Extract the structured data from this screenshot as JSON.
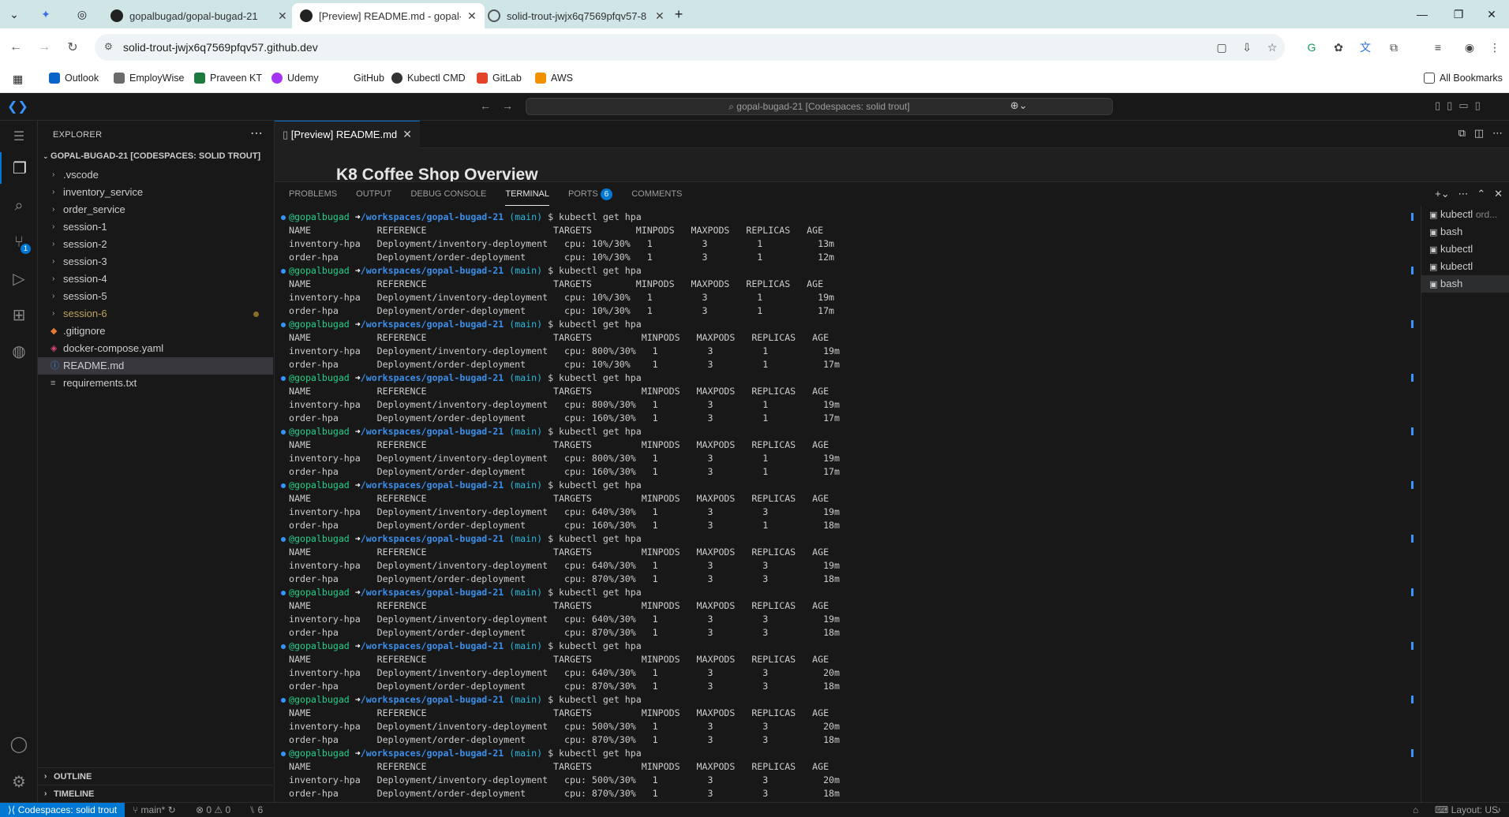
{
  "browser": {
    "tabs": [
      {
        "label": "gopalbugad/gopal-bugad-21",
        "active": false
      },
      {
        "label": "[Preview] README.md - gopal-b",
        "active": true
      },
      {
        "label": "solid-trout-jwjx6q7569pfqv57-8",
        "active": false
      }
    ],
    "url": "solid-trout-jwjx6q7569pfqv57.github.dev",
    "bookmarks": [
      "Outlook",
      "EmployWise",
      "Praveen KT",
      "Udemy",
      "GitHub",
      "Kubectl CMD",
      "GitLab",
      "AWS"
    ],
    "all_bookmarks": "All Bookmarks"
  },
  "vscode": {
    "command_center": "gopal-bugad-21 [Codespaces: solid trout]",
    "explorer": {
      "title": "EXPLORER",
      "root": "GOPAL-BUGAD-21 [CODESPACES: SOLID TROUT]",
      "items": [
        {
          "name": ".vscode",
          "type": "folder"
        },
        {
          "name": "inventory_service",
          "type": "folder"
        },
        {
          "name": "order_service",
          "type": "folder"
        },
        {
          "name": "session-1",
          "type": "folder"
        },
        {
          "name": "session-2",
          "type": "folder"
        },
        {
          "name": "session-3",
          "type": "folder"
        },
        {
          "name": "session-4",
          "type": "folder"
        },
        {
          "name": "session-5",
          "type": "folder"
        },
        {
          "name": "session-6",
          "type": "folder",
          "modified": true
        },
        {
          "name": ".gitignore",
          "type": "file"
        },
        {
          "name": "docker-compose.yaml",
          "type": "file"
        },
        {
          "name": "README.md",
          "type": "file",
          "selected": true
        },
        {
          "name": "requirements.txt",
          "type": "file"
        }
      ],
      "outline": "OUTLINE",
      "timeline": "TIMELINE"
    },
    "editor_tab": "[Preview] README.md",
    "preview_heading": "K8 Coffee Shop Overview",
    "panel_tabs": [
      "PROBLEMS",
      "OUTPUT",
      "DEBUG CONSOLE",
      "TERMINAL",
      "PORTS",
      "COMMENTS"
    ],
    "ports_count": "6",
    "terminal": {
      "prompt_user": "@gopalbugad",
      "prompt_path": "/workspaces/gopal-bugad-21",
      "prompt_branch": "(main)",
      "command": "$ kubectl get hpa",
      "blocks": [
        [
          "NAME            REFERENCE                       TARGETS        MINPODS   MAXPODS   REPLICAS   AGE",
          "inventory-hpa   Deployment/inventory-deployment   cpu: 10%/30%   1         3         1          13m",
          "order-hpa       Deployment/order-deployment       cpu: 10%/30%   1         3         1          12m"
        ],
        [
          "NAME            REFERENCE                       TARGETS        MINPODS   MAXPODS   REPLICAS   AGE",
          "inventory-hpa   Deployment/inventory-deployment   cpu: 10%/30%   1         3         1          19m",
          "order-hpa       Deployment/order-deployment       cpu: 10%/30%   1         3         1          17m"
        ],
        [
          "NAME            REFERENCE                       TARGETS         MINPODS   MAXPODS   REPLICAS   AGE",
          "inventory-hpa   Deployment/inventory-deployment   cpu: 800%/30%   1         3         1          19m",
          "order-hpa       Deployment/order-deployment       cpu: 10%/30%    1         3         1          17m"
        ],
        [
          "NAME            REFERENCE                       TARGETS         MINPODS   MAXPODS   REPLICAS   AGE",
          "inventory-hpa   Deployment/inventory-deployment   cpu: 800%/30%   1         3         1          19m",
          "order-hpa       Deployment/order-deployment       cpu: 160%/30%   1         3         1          17m"
        ],
        [
          "NAME            REFERENCE                       TARGETS         MINPODS   MAXPODS   REPLICAS   AGE",
          "inventory-hpa   Deployment/inventory-deployment   cpu: 800%/30%   1         3         1          19m",
          "order-hpa       Deployment/order-deployment       cpu: 160%/30%   1         3         1          17m"
        ],
        [
          "NAME            REFERENCE                       TARGETS         MINPODS   MAXPODS   REPLICAS   AGE",
          "inventory-hpa   Deployment/inventory-deployment   cpu: 640%/30%   1         3         3          19m",
          "order-hpa       Deployment/order-deployment       cpu: 160%/30%   1         3         1          18m"
        ],
        [
          "NAME            REFERENCE                       TARGETS         MINPODS   MAXPODS   REPLICAS   AGE",
          "inventory-hpa   Deployment/inventory-deployment   cpu: 640%/30%   1         3         3          19m",
          "order-hpa       Deployment/order-deployment       cpu: 870%/30%   1         3         3          18m"
        ],
        [
          "NAME            REFERENCE                       TARGETS         MINPODS   MAXPODS   REPLICAS   AGE",
          "inventory-hpa   Deployment/inventory-deployment   cpu: 640%/30%   1         3         3          19m",
          "order-hpa       Deployment/order-deployment       cpu: 870%/30%   1         3         3          18m"
        ],
        [
          "NAME            REFERENCE                       TARGETS         MINPODS   MAXPODS   REPLICAS   AGE",
          "inventory-hpa   Deployment/inventory-deployment   cpu: 640%/30%   1         3         3          20m",
          "order-hpa       Deployment/order-deployment       cpu: 870%/30%   1         3         3          18m"
        ],
        [
          "NAME            REFERENCE                       TARGETS         MINPODS   MAXPODS   REPLICAS   AGE",
          "inventory-hpa   Deployment/inventory-deployment   cpu: 500%/30%   1         3         3          20m",
          "order-hpa       Deployment/order-deployment       cpu: 870%/30%   1         3         3          18m"
        ],
        [
          "NAME            REFERENCE                       TARGETS         MINPODS   MAXPODS   REPLICAS   AGE",
          "inventory-hpa   Deployment/inventory-deployment   cpu: 500%/30%   1         3         3          20m",
          "order-hpa       Deployment/order-deployment       cpu: 870%/30%   1         3         3          18m"
        ]
      ]
    },
    "terminal_list": [
      {
        "label": "kubectl",
        "sub": "ord..."
      },
      {
        "label": "bash",
        "sub": ""
      },
      {
        "label": "kubectl",
        "sub": ""
      },
      {
        "label": "kubectl",
        "sub": ""
      },
      {
        "label": "bash",
        "sub": "",
        "selected": true
      }
    ],
    "status": {
      "remote": "Codespaces: solid trout",
      "branch": "main*",
      "problems": "0 ⚠ 0",
      "ports": "6",
      "layout": "Layout: US"
    }
  }
}
